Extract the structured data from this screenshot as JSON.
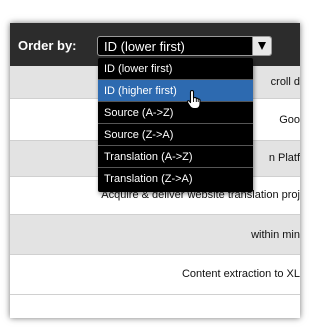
{
  "header": {
    "order_label": "Order by:",
    "select_value": "ID (lower first)"
  },
  "dropdown": {
    "options": [
      "ID (lower first)",
      "ID (higher first)",
      "Source (A->Z)",
      "Source (Z->A)",
      "Translation (A->Z)",
      "Translation (Z->A)"
    ],
    "highlighted_option": "ID (higher first)"
  },
  "rows": [
    {
      "text": "croll d"
    },
    {
      "text": "Goo"
    },
    {
      "text": "n Platf"
    },
    {
      "text": "Acquire & deliver website translation proj"
    },
    {
      "text": "within min"
    },
    {
      "text": "Content extraction to XL"
    }
  ],
  "colors": {
    "header_bg": "#2c2c2c",
    "dropdown_bg": "#000000",
    "highlight": "#2d6ab0",
    "row_gray": "#e3e3e3"
  },
  "icons": {
    "cursor": "hand-pointer-icon",
    "select_arrow": "chevron-down-icon"
  }
}
